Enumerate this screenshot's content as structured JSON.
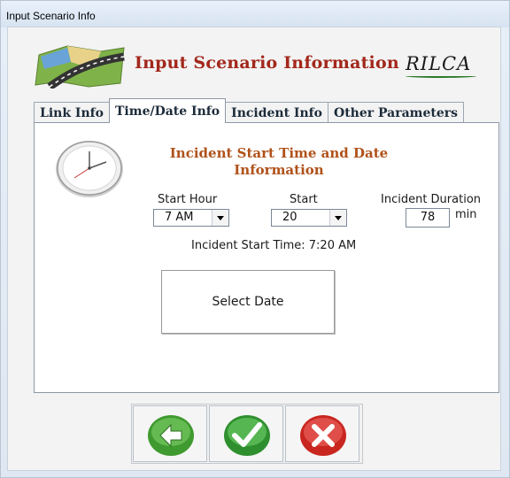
{
  "window": {
    "title": "Input Scenario Info"
  },
  "header": {
    "title": "Input Scenario Information",
    "brand": "RILCA"
  },
  "tabs": [
    {
      "label": "Link Info",
      "active": false
    },
    {
      "label": "Time/Date Info",
      "active": true
    },
    {
      "label": "Incident Info",
      "active": false
    },
    {
      "label": "Other Parameters",
      "active": false
    }
  ],
  "panel": {
    "section_title": "Incident Start Time and Date Information",
    "start_hour": {
      "label": "Start Hour",
      "value": "7 AM"
    },
    "start_minute": {
      "label": "Start",
      "value": "20"
    },
    "duration": {
      "label": "Incident Duration",
      "value": "78",
      "unit": "min"
    },
    "start_time_text": "Incident Start Time: 7:20 AM",
    "select_date_label": "Select Date"
  },
  "buttons": [
    {
      "name": "back",
      "icon": "back-arrow-icon",
      "color": "#4caf3a"
    },
    {
      "name": "ok",
      "icon": "checkmark-icon",
      "color": "#3aa53a"
    },
    {
      "name": "cancel",
      "icon": "close-icon",
      "color": "#d9302a"
    }
  ]
}
